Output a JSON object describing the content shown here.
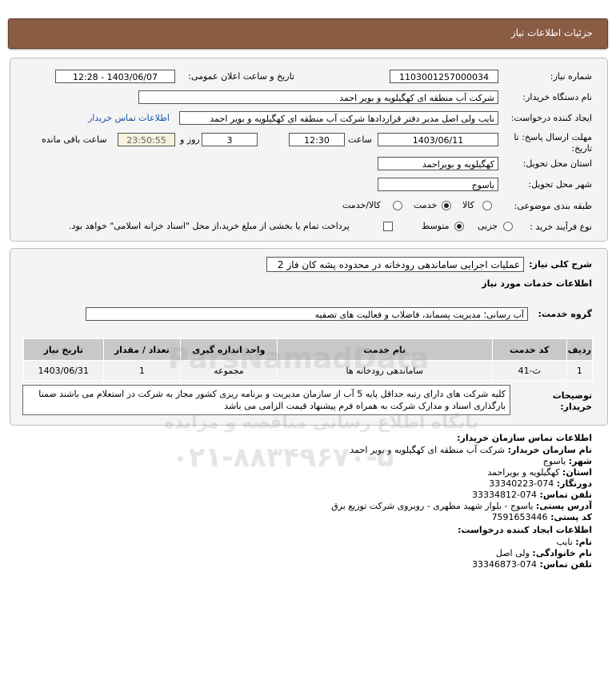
{
  "header": {
    "title": "جزئیات اطلاعات نیاز"
  },
  "form": {
    "need_number_label": "شماره نیاز:",
    "need_number": "1103001257000034",
    "announce_label": "تاریخ و ساعت اعلان عمومی:",
    "announce_value": "1403/06/07 - 12:28",
    "buyer_label": "نام دستگاه خریدار:",
    "buyer_value": "شرکت آب منطقه ای کهگیلویه و بویر احمد",
    "creator_label": "ایجاد کننده درخواست:",
    "creator_value": "نایب ولی اصل مدیر دفتر قراردادها شرکت آب منطقه ای کهگیلویه و بویر احمد",
    "buyer_contact_link": "اطلاعات تماس خریدار",
    "deadline_label_1": "مهلت ارسال پاسخ: تا",
    "deadline_label_2": "تاریخ:",
    "deadline_date": "1403/06/11",
    "time_label": "ساعت",
    "deadline_time": "12:30",
    "days_value": "3",
    "days_label": "روز و",
    "remaining_time": "23:50:55",
    "remaining_label": "ساعت باقی مانده",
    "province_label": "استان محل تحویل:",
    "province_value": "کهگیلویه و بویراحمد",
    "city_label": "شهر محل تحویل:",
    "city_value": "یاسوج",
    "category_label": "طبقه بندی موضوعی:",
    "category_options": [
      "کالا",
      "خدمت",
      "کالا/خدمت"
    ],
    "category_selected": "خدمت",
    "process_label": "نوع فرآیند خرید :",
    "process_options": [
      "جزیی",
      "متوسط"
    ],
    "process_selected": "متوسط",
    "payment_note": "پرداخت تمام یا بخشی از مبلغ خرید،از محل \"اسناد خزانه اسلامی\" خواهد بود."
  },
  "summary": {
    "label": "شرح کلی نیاز:",
    "value": "عملیات اجرایی ساماندهی رودخانه در محدوده پشه کان فاز 2",
    "services_heading": "اطلاعات خدمات مورد نیاز",
    "group_label": "گروه خدمت:",
    "group_value": "آب رسانی؛ مدیریت پسماند، فاضلاب و فعالیت های تصفیه"
  },
  "table": {
    "headers": [
      "ردیف",
      "کد خدمت",
      "نام خدمت",
      "واحد اندازه گیری",
      "تعداد / مقدار",
      "تاریخ نیاز"
    ],
    "rows": [
      [
        "1",
        "ث-41",
        "ساماندهی رودخانه ها",
        "مجموعه",
        "1",
        "1403/06/31"
      ]
    ]
  },
  "notes": {
    "label": "توضیحات خریدار:",
    "text": "کلیه شرکت های دارای رتبه حداقل پایه 5 آب از سازمان مدیریت و برنامه ریزی کشور مجاز به شرکت در استعلام می باشند ضمنا بارگذاری اسناد و مدارک شرکت به همراه فرم پیشنهاد قیمت الزامی می باشد"
  },
  "contact": {
    "org_heading": "اطلاعات تماس سازمان خریدار:",
    "org_name_label": "نام سازمان خریدار:",
    "org_name": "شرکت آب منطقه ای کهگیلویه و بویر احمد",
    "city_label": "شهر:",
    "city": "یاسوج",
    "province_label": "استان:",
    "province": "کهگیلویه و بویراحمد",
    "fax_label": "دورنگار:",
    "fax": "074-33340223",
    "phone_label": "تلفن تماس:",
    "phone": "074-33334812",
    "address_label": "آدرس پستی:",
    "address": "یاسوج - بلوار شهید مطهری - روبروی شرکت توزیع برق",
    "postal_label": "کد پستی:",
    "postal": "7591653446",
    "creator_heading": "اطلاعات ایجاد کننده درخواست:",
    "first_name_label": "نام:",
    "first_name": "نایب",
    "last_name_label": "نام خانوادگی:",
    "last_name": "ولی اصل",
    "creator_phone_label": "تلفن تماس:",
    "creator_phone": "074-33346873"
  },
  "watermark": {
    "brand": "ParsNamadData",
    "tagline": "پایگاه اطلاع رسانی مناقصه و مزایده",
    "phone": "۰۲۱-۸۸۳۴۹۶۷۰-۵"
  }
}
